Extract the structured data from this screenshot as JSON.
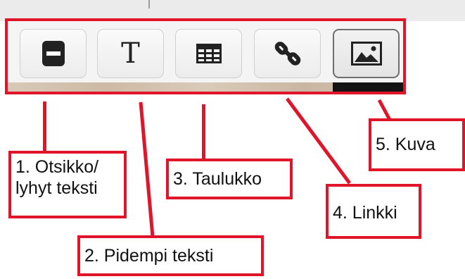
{
  "toolbar": {
    "buttons": [
      {
        "icon": "heading-block-icon"
      },
      {
        "icon": "text-T-icon",
        "glyph": "T"
      },
      {
        "icon": "table-grid-icon"
      },
      {
        "icon": "chain-link-icon"
      },
      {
        "icon": "image-icon"
      }
    ]
  },
  "callouts": {
    "c1_line1": "1. Otsikko/",
    "c1_line2": "lyhyt teksti",
    "c2": "2. Pidempi teksti",
    "c3": "3. Taulukko",
    "c4": "4. Linkki",
    "c5": "5. Kuva"
  },
  "colors": {
    "annotation_red": "#e0152a",
    "icon_dark": "#222222"
  }
}
